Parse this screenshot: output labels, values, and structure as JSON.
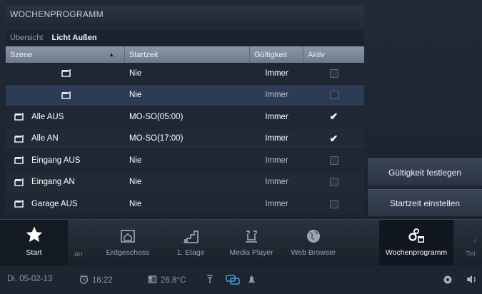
{
  "panel": {
    "title": "WOCHENPROGRAMM",
    "tabs": [
      {
        "label": "Übersicht",
        "active": false
      },
      {
        "label": "Licht Außen",
        "active": true
      }
    ]
  },
  "table": {
    "headers": {
      "scene": "Szene",
      "start": "Startzeit",
      "validity": "Gültigkeit",
      "active": "Aktiv"
    },
    "sort_indicator": "▲",
    "rows": [
      {
        "scene": "",
        "start": "Nie",
        "validity": "Immer",
        "active": false,
        "selected": false
      },
      {
        "scene": "",
        "start": "Nie",
        "validity": "Immer",
        "active": false,
        "selected": true
      },
      {
        "scene": "Alle AUS",
        "start": "MO-SO(05:00)",
        "validity": "Immer",
        "active": true,
        "selected": false
      },
      {
        "scene": "Alle AN",
        "start": "MO-SO(17:00)",
        "validity": "Immer",
        "active": true,
        "selected": false
      },
      {
        "scene": "Eingang AUS",
        "start": "Nie",
        "validity": "Immer",
        "active": false,
        "selected": false
      },
      {
        "scene": "Eingang AN",
        "start": "Nie",
        "validity": "Immer",
        "active": false,
        "selected": false
      },
      {
        "scene": "Garage AUS",
        "start": "Nie",
        "validity": "Immer",
        "active": false,
        "selected": false
      }
    ]
  },
  "actions": {
    "set_validity": "Gültigkeit festlegen",
    "set_start": "Startzeit einstellen"
  },
  "dock": {
    "start": "Start",
    "partial_left": "an",
    "items": [
      "Erdgeschoss",
      "1. Etage",
      "Media Player",
      "Web Browser",
      "Wochenprogramm"
    ],
    "partial_right": "Tel",
    "active": "Wochenprogramm"
  },
  "status": {
    "date": "Di. 05-02-13",
    "time": "16:22",
    "temperature": "26.8°C"
  },
  "colors": {
    "accent_blue": "#2c3c54",
    "header_gray": "#7d8a9c",
    "status_blue": "#3aa0e0"
  }
}
